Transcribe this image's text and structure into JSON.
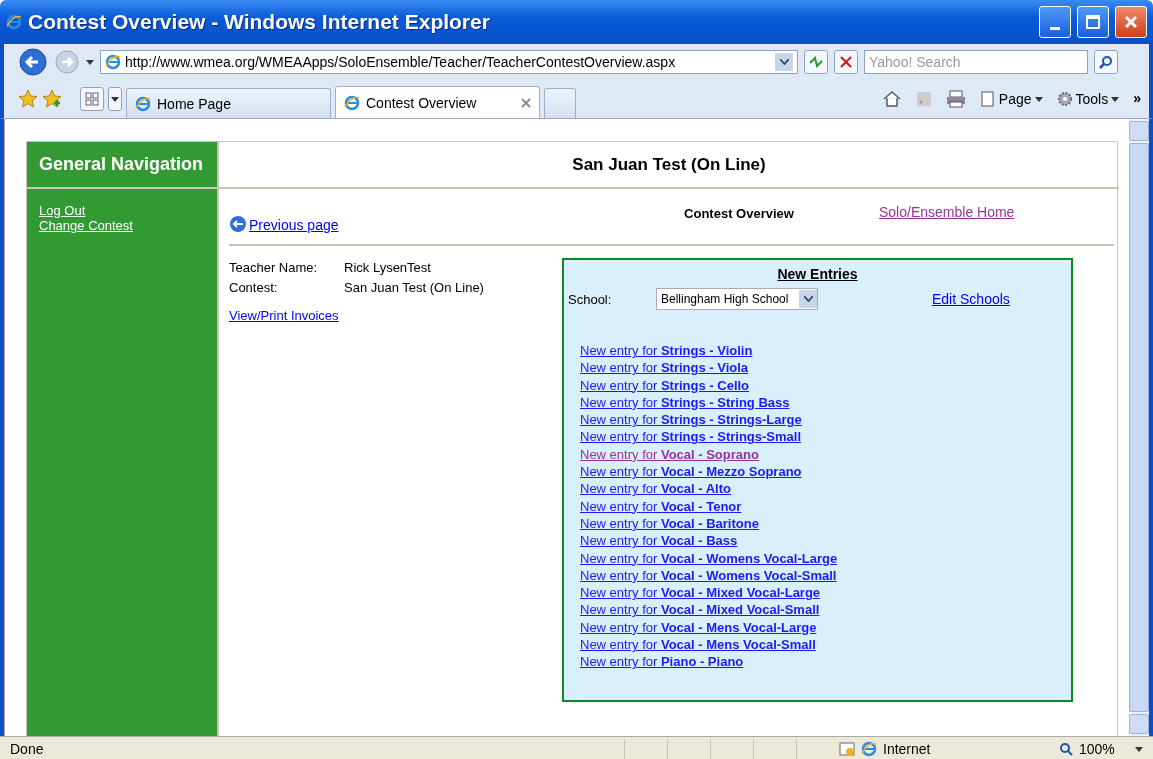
{
  "window": {
    "title": "Contest Overview - Windows Internet Explorer"
  },
  "address_bar": {
    "url": "http://www.wmea.org/WMEAApps/SoloEnsemble/Teacher/TeacherContestOverview.aspx"
  },
  "search": {
    "placeholder": "Yahoo! Search"
  },
  "tabs": [
    {
      "label": "Home Page",
      "selected": false
    },
    {
      "label": "Contest Overview",
      "selected": true
    }
  ],
  "toolbar": {
    "page": "Page",
    "tools": "Tools",
    "more": "»"
  },
  "nav": {
    "title": "General Navigation",
    "links": [
      "Log Out",
      "Change Contest"
    ]
  },
  "page": {
    "title": "San Juan Test (On Line)",
    "previous": "Previous page",
    "heading": "Contest Overview",
    "home_link": "Solo/Ensemble Home"
  },
  "info": [
    {
      "label": "Teacher Name:",
      "value": "Rick LysenTest"
    },
    {
      "label": "Contest:",
      "value": "San Juan Test (On Line)"
    }
  ],
  "invoices_link": "View/Print Invoices",
  "entries": {
    "title": "New Entries",
    "school_label": "School:",
    "school": "Bellingham High School",
    "edit_link": "Edit Schools",
    "links": [
      {
        "text": "New entry for **Strings - Violin**",
        "visited": false
      },
      {
        "text": "New entry for **Strings - Viola**",
        "visited": false
      },
      {
        "text": "New entry for **Strings - Cello**",
        "visited": false
      },
      {
        "text": "New entry for **Strings - String Bass**",
        "visited": false
      },
      {
        "text": "New entry for **Strings - Strings-Large**",
        "visited": false
      },
      {
        "text": "New entry for **Strings - Strings-Small**",
        "visited": false
      },
      {
        "text": "New entry for **Vocal - Soprano**",
        "visited": true
      },
      {
        "text": "New entry for **Vocal - Mezzo Soprano**",
        "visited": false
      },
      {
        "text": "New entry for **Vocal - Alto**",
        "visited": false
      },
      {
        "text": "New entry for **Vocal - Tenor**",
        "visited": false
      },
      {
        "text": "New entry for **Vocal - Baritone**",
        "visited": false
      },
      {
        "text": "New entry for **Vocal - Bass**",
        "visited": false
      },
      {
        "text": "New entry for **Vocal - Womens Vocal-Large**",
        "visited": false
      },
      {
        "text": "New entry for **Vocal - Womens Vocal-Small**",
        "visited": false
      },
      {
        "text": "New entry for **Vocal - Mixed Vocal-Large**",
        "visited": false
      },
      {
        "text": "New entry for **Vocal - Mixed Vocal-Small**",
        "visited": false
      },
      {
        "text": "New entry for **Vocal - Mens Vocal-Large**",
        "visited": false
      },
      {
        "text": "New entry for **Vocal - Mens Vocal-Small**",
        "visited": false
      },
      {
        "text": "New entry for **Piano - Piano**",
        "visited": false
      }
    ]
  },
  "status_bar": {
    "text": "Done",
    "zone": "Internet",
    "zoom": "100%"
  }
}
